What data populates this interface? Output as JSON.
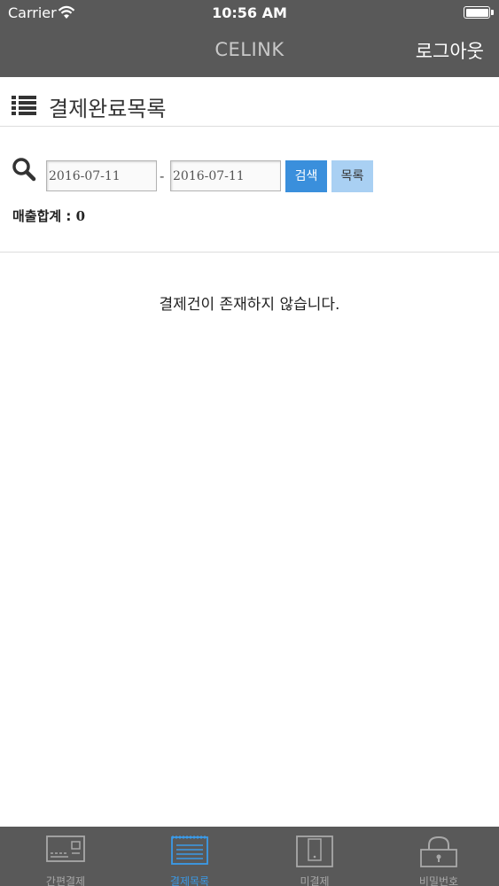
{
  "status_bar": {
    "carrier": "Carrier",
    "time": "10:56 AM"
  },
  "nav": {
    "title": "CELINK",
    "logout_label": "로그아웃"
  },
  "page": {
    "title": "결제완료목록"
  },
  "search": {
    "date_from": "2016-07-11",
    "date_to": "2016-07-11",
    "separator": "-",
    "search_button": "검색",
    "list_button": "목록"
  },
  "summary": {
    "sales_total_label": "매출합계 : ",
    "sales_total_value": "0"
  },
  "empty_message": "결제건이 존재하지 않습니다.",
  "tabs": [
    {
      "label": "간편결제",
      "icon": "card-terminal-icon",
      "active": false
    },
    {
      "label": "결제목록",
      "icon": "receipt-list-icon",
      "active": true
    },
    {
      "label": "미결제",
      "icon": "tablet-icon",
      "active": false
    },
    {
      "label": "비밀번호",
      "icon": "lock-icon",
      "active": false
    }
  ],
  "colors": {
    "header_bg": "#595959",
    "accent": "#3a8fdc",
    "tab_active": "#3a9ae8"
  }
}
